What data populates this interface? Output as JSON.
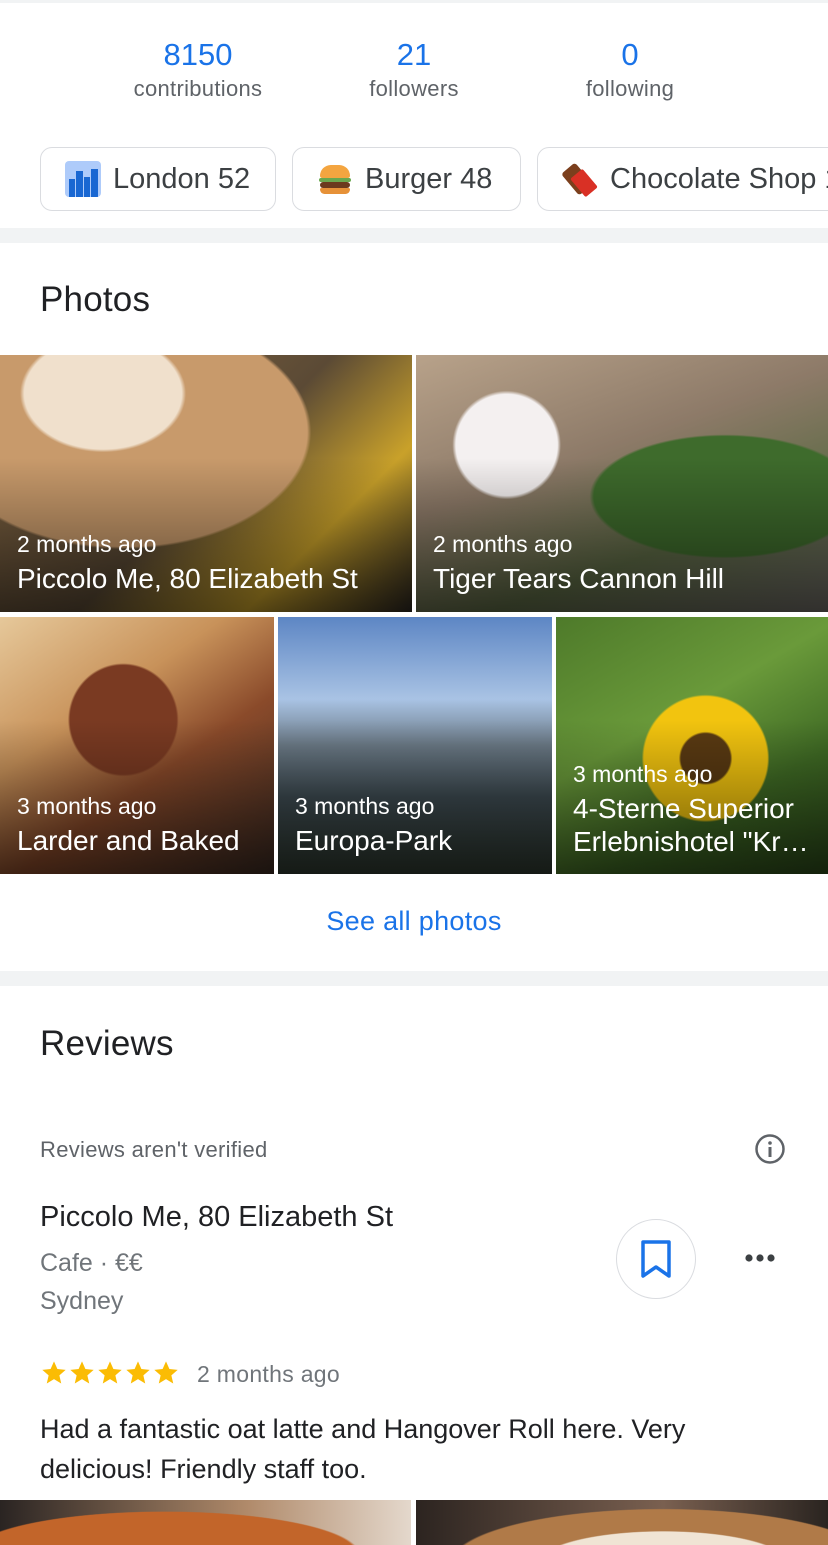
{
  "stats": [
    {
      "value": "8150",
      "label": "contributions"
    },
    {
      "value": "21",
      "label": "followers"
    },
    {
      "value": "0",
      "label": "following"
    }
  ],
  "chips": [
    {
      "icon": "cityscape-icon",
      "label": "London 52"
    },
    {
      "icon": "burger-icon",
      "label": "Burger 48"
    },
    {
      "icon": "chocolate-bar-icon",
      "label": "Chocolate Shop 1"
    }
  ],
  "photos_section": {
    "heading": "Photos",
    "items": [
      {
        "when": "2 months ago",
        "title": "Piccolo Me, 80 Elizabeth St"
      },
      {
        "when": "2 months ago",
        "title": "Tiger Tears Cannon Hill"
      },
      {
        "when": "3 months ago",
        "title": "Larder and Baked"
      },
      {
        "when": "3 months ago",
        "title": "Europa-Park"
      },
      {
        "when": "3 months ago",
        "title": "4-Sterne Superior Erlebnishotel \"Kr…"
      }
    ],
    "see_all": "See all photos"
  },
  "reviews_section": {
    "heading": "Reviews",
    "notice": "Reviews aren't verified",
    "review": {
      "place": "Piccolo Me, 80 Elizabeth St",
      "category": "Cafe · €€",
      "city": "Sydney",
      "rating": 5,
      "when": "2 months ago",
      "text": "Had a fantastic oat latte and Hangover Roll here. Very delicious! Friendly staff too."
    }
  },
  "colors": {
    "accent": "#1a73e8",
    "star": "#fbbc04",
    "divider": "#f1f3f4"
  }
}
